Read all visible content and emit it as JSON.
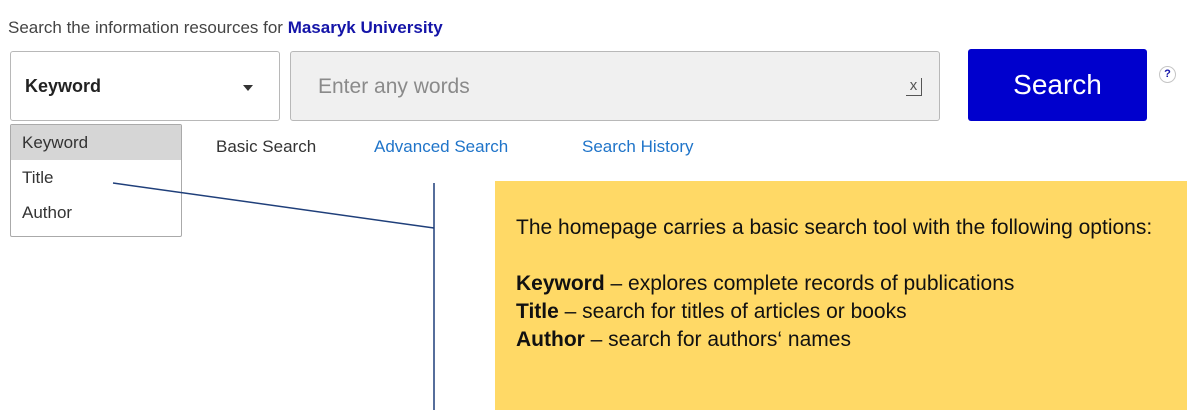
{
  "header": {
    "prefix": "Search the information resources for ",
    "institution": "Masaryk University"
  },
  "search": {
    "selected_field": "Keyword",
    "placeholder": "Enter any words",
    "clear_symbol": "x",
    "button_label": "Search",
    "help_symbol": "?"
  },
  "dropdown": {
    "options": [
      "Keyword",
      "Title",
      "Author"
    ],
    "highlighted": "Keyword"
  },
  "tabs": [
    {
      "label": "Basic Search",
      "active": true
    },
    {
      "label": "Advanced Search",
      "active": false
    },
    {
      "label": "Search History",
      "active": false
    }
  ],
  "callout": {
    "intro": "The homepage carries a basic search tool with the following options:",
    "items": [
      {
        "term": "Keyword",
        "text": " – explores complete records of publications"
      },
      {
        "term": "Title",
        "text": " – search for titles of articles or books"
      },
      {
        "term": "Author",
        "text": " – search for authors‘ names"
      }
    ]
  },
  "colors": {
    "search_button": "#0000cd",
    "institution_link": "#1414a8",
    "tab_link": "#1f74c9",
    "callout_bg": "#ffd966",
    "connector_line": "#1f3f7a"
  }
}
